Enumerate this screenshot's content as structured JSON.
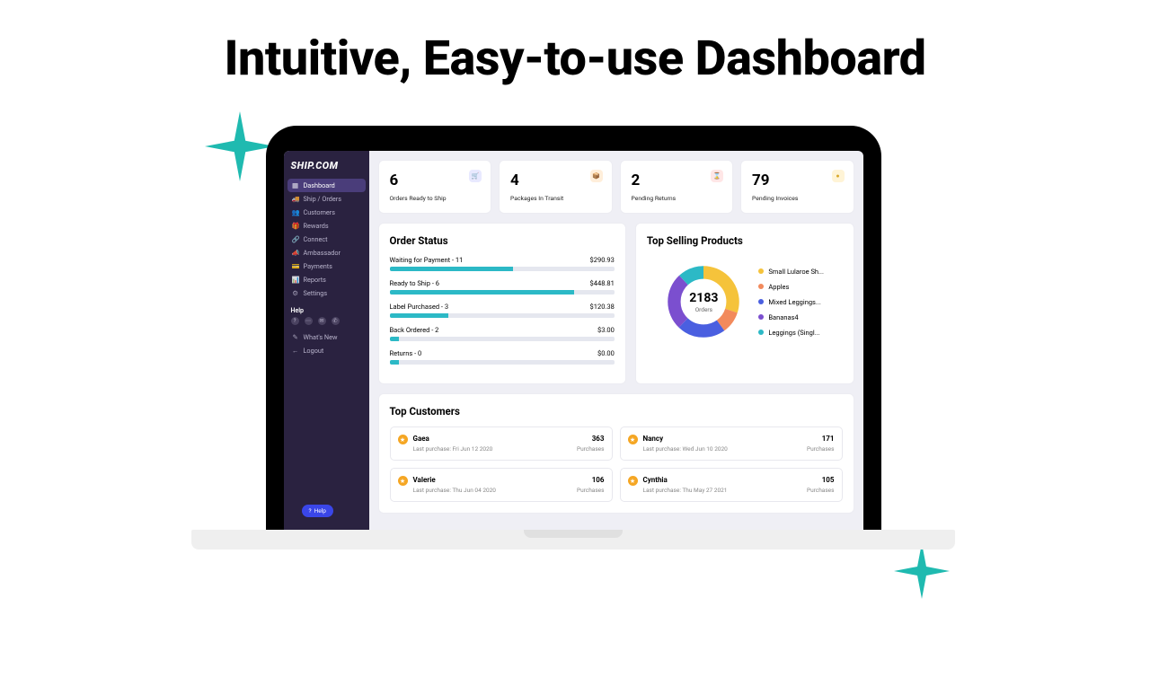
{
  "hero": {
    "title": "Intuitive, Easy-to-use Dashboard"
  },
  "logo": {
    "brand": "SHIP.COM"
  },
  "sidebar": {
    "items": [
      {
        "label": "Dashboard",
        "icon": "▦"
      },
      {
        "label": "Ship / Orders",
        "icon": "🚚"
      },
      {
        "label": "Customers",
        "icon": "👥"
      },
      {
        "label": "Rewards",
        "icon": "🎁"
      },
      {
        "label": "Connect",
        "icon": "🔗"
      },
      {
        "label": "Ambassador",
        "icon": "📣"
      },
      {
        "label": "Payments",
        "icon": "💳"
      },
      {
        "label": "Reports",
        "icon": "📊"
      },
      {
        "label": "Settings",
        "icon": "⚙"
      }
    ],
    "help_heading": "Help",
    "sublinks": [
      {
        "label": "What's New",
        "icon": "✎"
      },
      {
        "label": "Logout",
        "icon": "←"
      }
    ],
    "help_pill": {
      "icon": "?",
      "label": "Help"
    }
  },
  "stats": [
    {
      "value": "6",
      "label": "Orders Ready to Ship",
      "icon": "🛒",
      "cls": "ic-blue"
    },
    {
      "value": "4",
      "label": "Packages In Transit",
      "icon": "📦",
      "cls": "ic-orange"
    },
    {
      "value": "2",
      "label": "Pending Returns",
      "icon": "⌛",
      "cls": "ic-red"
    },
    {
      "value": "79",
      "label": "Pending Invoices",
      "icon": "●",
      "cls": "ic-yellow"
    }
  ],
  "order_status": {
    "title": "Order Status",
    "rows": [
      {
        "label": "Waiting for Payment - 11",
        "amount": "$290.93",
        "pct": 55
      },
      {
        "label": "Ready to Ship - 6",
        "amount": "$448.81",
        "pct": 82
      },
      {
        "label": "Label Purchased - 3",
        "amount": "$120.38",
        "pct": 26
      },
      {
        "label": "Back Ordered - 2",
        "amount": "$3.00",
        "pct": 4
      },
      {
        "label": "Returns - 0",
        "amount": "$0.00",
        "pct": 4
      }
    ]
  },
  "top_selling": {
    "title": "Top Selling Products",
    "total": "2183",
    "total_label": "Orders",
    "legend": [
      {
        "label": "Small Lularoe Sh...",
        "color": "#f5c33b"
      },
      {
        "label": "Apples",
        "color": "#f28a5c"
      },
      {
        "label": "Mixed Leggings...",
        "color": "#4a5fe0"
      },
      {
        "label": "Bananas4",
        "color": "#7b4fcf"
      },
      {
        "label": "Leggings (Singl...",
        "color": "#2cb9c6"
      }
    ]
  },
  "chart_data": {
    "type": "pie",
    "title": "Top Selling Products",
    "categories": [
      "Small Lularoe Sh...",
      "Apples",
      "Mixed Leggings...",
      "Bananas4",
      "Leggings (Singl..."
    ],
    "values": [
      30,
      10,
      22,
      26,
      12
    ],
    "colors": [
      "#f5c33b",
      "#f28a5c",
      "#4a5fe0",
      "#7b4fcf",
      "#2cb9c6"
    ],
    "center_value": 2183,
    "center_label": "Orders"
  },
  "top_customers": {
    "title": "Top Customers",
    "purchases_label": "Purchases",
    "last_purchase_prefix": "Last purchase: ",
    "items": [
      {
        "name": "Gaea",
        "last": "Fri Jun 12 2020",
        "count": "363"
      },
      {
        "name": "Nancy",
        "last": "Wed Jun 10 2020",
        "count": "171"
      },
      {
        "name": "Valerie",
        "last": "Thu Jun 04 2020",
        "count": "106"
      },
      {
        "name": "Cynthia",
        "last": "Thu May 27 2021",
        "count": "105"
      }
    ]
  }
}
